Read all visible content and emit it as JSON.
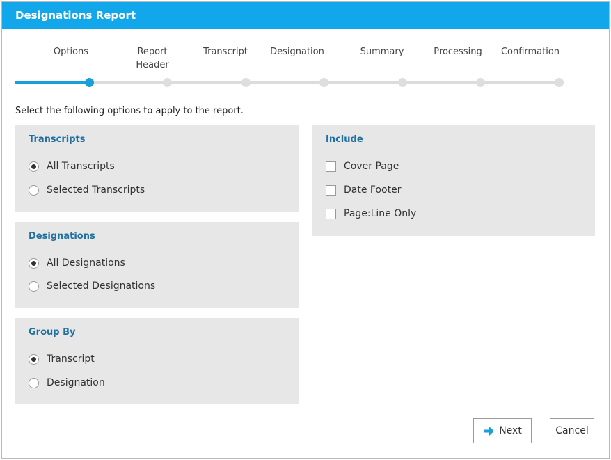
{
  "window": {
    "title": "Designations Report"
  },
  "wizard": {
    "steps": [
      {
        "label": "Options"
      },
      {
        "label": "Report Header"
      },
      {
        "label": "Transcript"
      },
      {
        "label": "Designation"
      },
      {
        "label": "Summary"
      },
      {
        "label": "Processing"
      },
      {
        "label": "Confirmation"
      }
    ],
    "current_step": 1,
    "total_steps": 7
  },
  "instructions": "Select the following options to apply to the report.",
  "transcripts": {
    "title": "Transcripts",
    "options": [
      {
        "label": "All Transcripts",
        "selected": true
      },
      {
        "label": "Selected Transcripts",
        "selected": false
      }
    ]
  },
  "designations": {
    "title": "Designations",
    "options": [
      {
        "label": "All Designations",
        "selected": true
      },
      {
        "label": "Selected Designations",
        "selected": false
      }
    ]
  },
  "group_by": {
    "title": "Group By",
    "options": [
      {
        "label": "Transcript",
        "selected": true
      },
      {
        "label": "Designation",
        "selected": false
      }
    ]
  },
  "include": {
    "title": "Include",
    "options": [
      {
        "label": "Cover Page",
        "checked": false
      },
      {
        "label": "Date Footer",
        "checked": false
      },
      {
        "label": "Page:Line Only",
        "checked": false
      }
    ]
  },
  "buttons": {
    "next": "Next",
    "cancel": "Cancel"
  },
  "icons": {
    "next": "arrow-right-icon"
  },
  "colors": {
    "accent": "#12a6ea",
    "progress": "#1a9fdb",
    "section_title": "#1f6fa0",
    "panel_bg": "#e7e7e7"
  }
}
